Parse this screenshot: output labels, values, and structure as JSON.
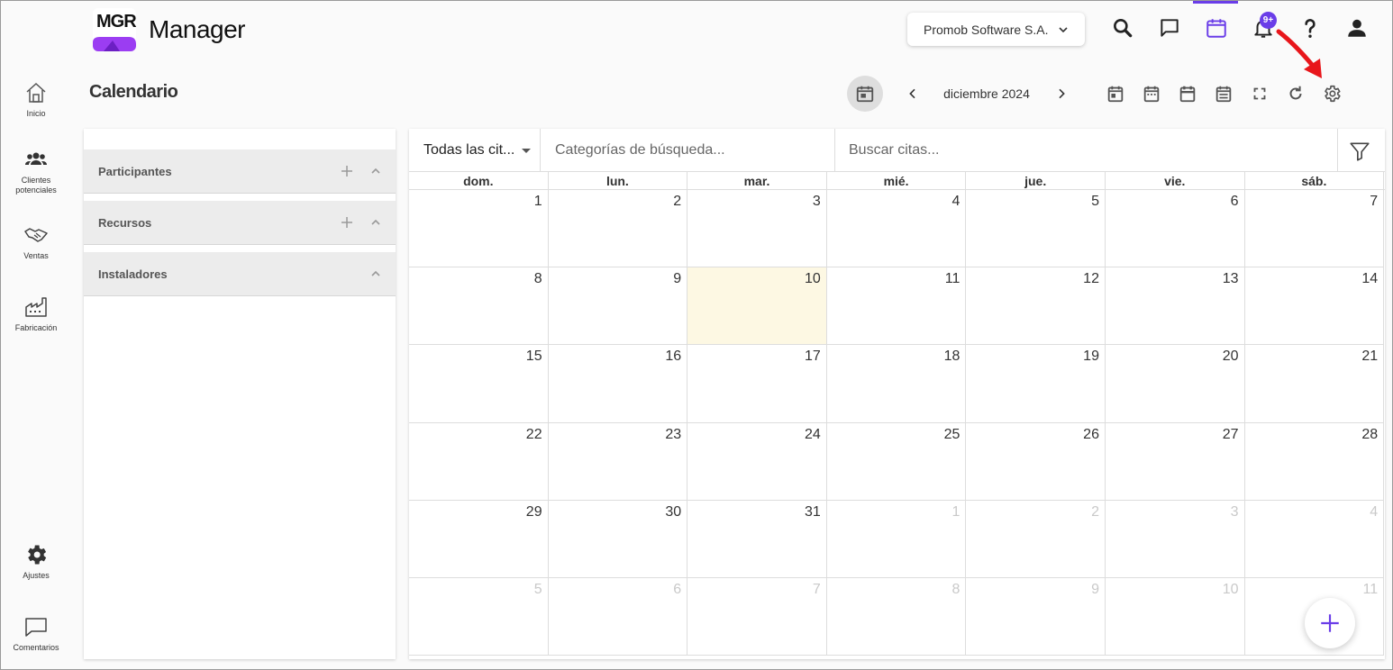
{
  "app": {
    "logo_text": "MGR",
    "title": "Manager"
  },
  "header": {
    "company": "Promob Software S.A.",
    "notification_badge": "9+",
    "icons": [
      "search-icon",
      "chat-icon",
      "calendar-icon",
      "bell-icon",
      "help-icon",
      "user-icon"
    ],
    "accent_color": "#6a3de8"
  },
  "sidebar": {
    "items": [
      {
        "label": "Inicio",
        "icon": "home-icon"
      },
      {
        "label": "Clientes potenciales",
        "icon": "group-icon"
      },
      {
        "label": "Ventas",
        "icon": "handshake-icon"
      },
      {
        "label": "Fabricación",
        "icon": "factory-icon"
      }
    ],
    "bottom": [
      {
        "label": "Ajustes",
        "icon": "gear-icon"
      },
      {
        "label": "Comentarios",
        "icon": "comment-icon"
      }
    ]
  },
  "page": {
    "title": "Calendario",
    "month": "diciembre 2024"
  },
  "panel": {
    "sections": [
      {
        "label": "Participantes",
        "addable": true
      },
      {
        "label": "Recursos",
        "addable": true
      },
      {
        "label": "Instaladores",
        "addable": false
      }
    ]
  },
  "calendar": {
    "filter_select": "Todas las cit...",
    "category_placeholder": "Categorías de búsqueda...",
    "search_placeholder": "Buscar citas...",
    "weekdays": [
      "dom.",
      "lun.",
      "mar.",
      "mié.",
      "jue.",
      "vie.",
      "sáb."
    ],
    "today": 10,
    "days": [
      {
        "d": "1"
      },
      {
        "d": "2"
      },
      {
        "d": "3"
      },
      {
        "d": "4"
      },
      {
        "d": "5"
      },
      {
        "d": "6"
      },
      {
        "d": "7"
      },
      {
        "d": "8"
      },
      {
        "d": "9"
      },
      {
        "d": "10",
        "today": true
      },
      {
        "d": "11"
      },
      {
        "d": "12"
      },
      {
        "d": "13"
      },
      {
        "d": "14"
      },
      {
        "d": "15"
      },
      {
        "d": "16"
      },
      {
        "d": "17"
      },
      {
        "d": "18"
      },
      {
        "d": "19"
      },
      {
        "d": "20"
      },
      {
        "d": "21"
      },
      {
        "d": "22"
      },
      {
        "d": "23"
      },
      {
        "d": "24"
      },
      {
        "d": "25"
      },
      {
        "d": "26"
      },
      {
        "d": "27"
      },
      {
        "d": "28"
      },
      {
        "d": "29"
      },
      {
        "d": "30"
      },
      {
        "d": "31"
      },
      {
        "d": "1",
        "other": true
      },
      {
        "d": "2",
        "other": true
      },
      {
        "d": "3",
        "other": true
      },
      {
        "d": "4",
        "other": true
      },
      {
        "d": "5",
        "other": true
      },
      {
        "d": "6",
        "other": true
      },
      {
        "d": "7",
        "other": true
      },
      {
        "d": "8",
        "other": true
      },
      {
        "d": "9",
        "other": true
      },
      {
        "d": "10",
        "other": true
      },
      {
        "d": "11",
        "other": true
      }
    ]
  }
}
